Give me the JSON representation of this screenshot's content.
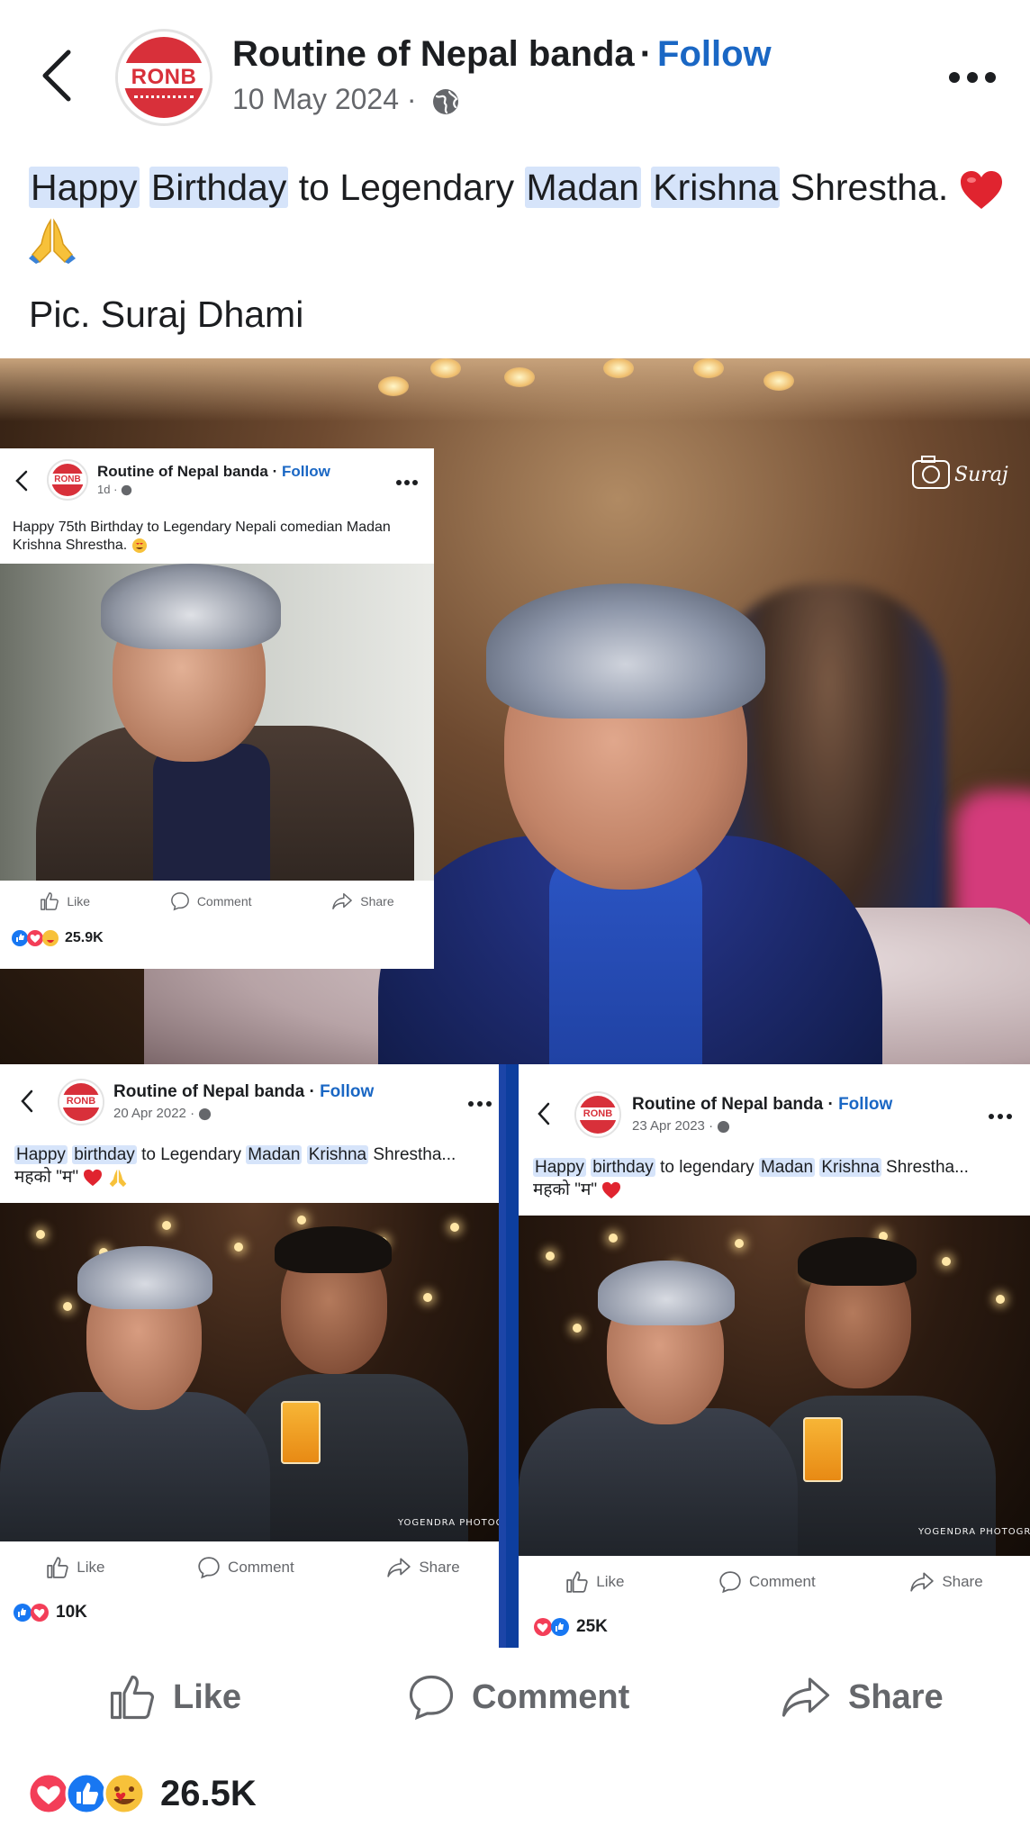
{
  "header": {
    "page_name": "Routine of Nepal banda",
    "separator": "·",
    "follow_label": "Follow",
    "date": "10 May 2024 ·",
    "avatar_text": "RONB"
  },
  "post": {
    "caption_parts": [
      "Happy",
      "Birthday",
      "to Legendary",
      "Madan",
      "Krishna",
      "Shrestha."
    ],
    "credit": "Pic. Suraj Dhami"
  },
  "photo": {
    "watermark": "Suraj"
  },
  "card1": {
    "avatar_text": "RONB",
    "page_name": "Routine of Nepal banda",
    "separator": "·",
    "follow_label": "Follow",
    "date": "1d ·",
    "caption": "Happy 75th Birthday to Legendary Nepali comedian Madan Krishna Shrestha.",
    "like_label": "Like",
    "comment_label": "Comment",
    "share_label": "Share",
    "reaction_count": "25.9K"
  },
  "card2": {
    "avatar_text": "RONB",
    "page_name": "Routine of Nepal banda",
    "separator": "·",
    "follow_label": "Follow",
    "date": "20 Apr 2022 ·",
    "caption_parts": [
      "Happy",
      "birthday",
      "to Legendary",
      "Madan",
      "Krishna",
      "Shrestha..."
    ],
    "caption_line2": "महको \"म\"",
    "photo_watermark": "YOGENDRA PHOTOGRAPHY",
    "like_label": "Like",
    "comment_label": "Comment",
    "share_label": "Share",
    "reaction_count": "10K"
  },
  "card3": {
    "avatar_text": "RONB",
    "page_name": "Routine of Nepal banda",
    "separator": "·",
    "follow_label": "Follow",
    "date": "23 Apr 2023 ·",
    "caption_parts": [
      "Happy",
      "birthday",
      "to legendary",
      "Madan",
      "Krishna",
      "Shrestha..."
    ],
    "caption_line2": "महको \"म\"",
    "photo_watermark": "YOGENDRA PHOTOGRAPHY",
    "like_label": "Like",
    "comment_label": "Comment",
    "share_label": "Share",
    "reaction_count": "25K"
  },
  "actions": {
    "like_label": "Like",
    "comment_label": "Comment",
    "share_label": "Share"
  },
  "reactions": {
    "count": "26.5K"
  },
  "colors": {
    "accent": "#1a67c4",
    "highlight": "#d6e4fa",
    "brand_red": "#d8303a",
    "secondary_text": "#65676b"
  }
}
